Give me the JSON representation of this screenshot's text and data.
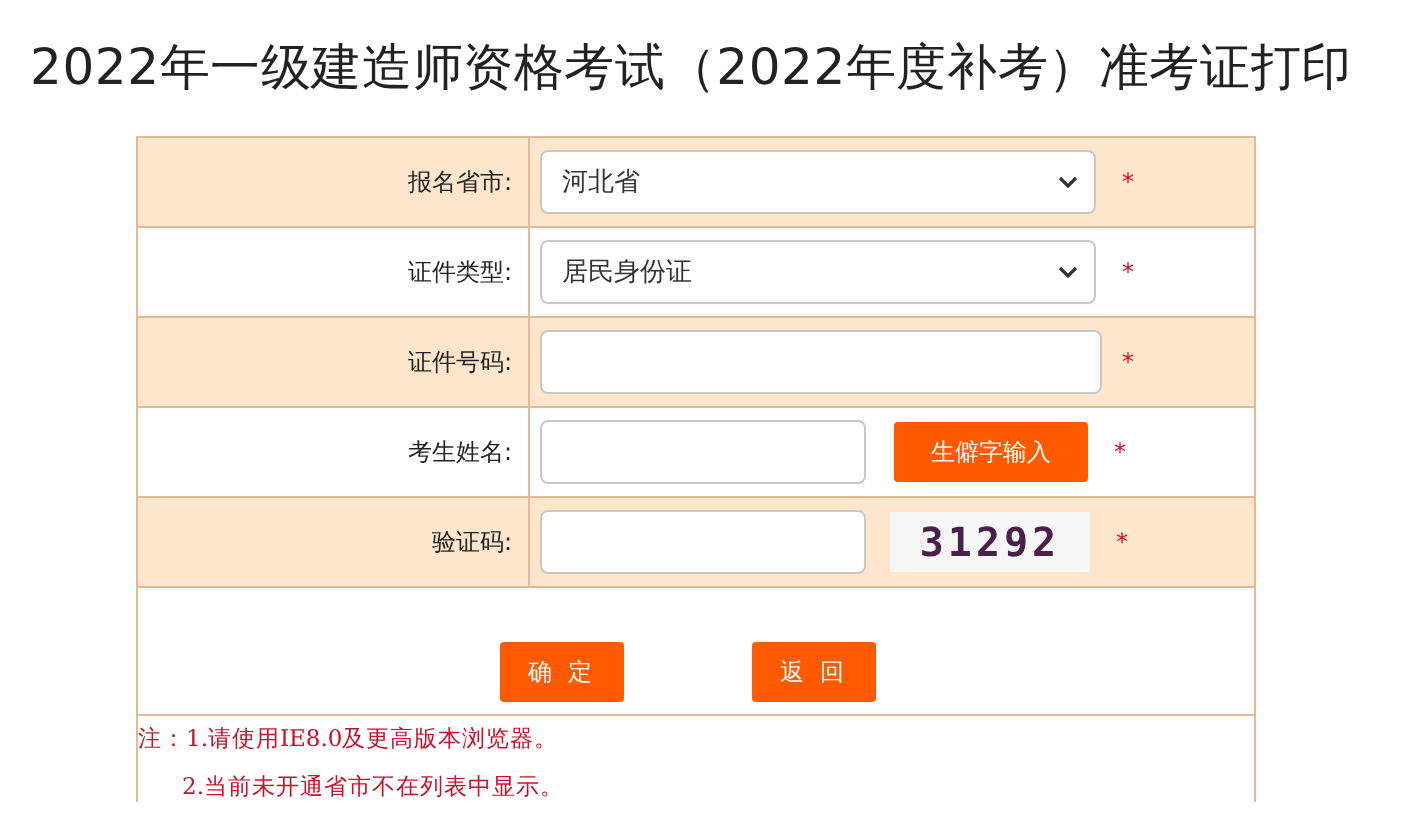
{
  "title": "2022年一级建造师资格考试（2022年度补考）准考证打印",
  "rows": [
    {
      "kind": "select",
      "label": "报名省市:",
      "value": "河北省",
      "required": "*"
    },
    {
      "kind": "select",
      "label": "证件类型:",
      "value": "居民身份证",
      "required": "*"
    },
    {
      "kind": "input",
      "label": "证件号码:",
      "required": "*"
    },
    {
      "kind": "button",
      "label": "考生姓名:",
      "button": "生僻字输入",
      "required": "*"
    },
    {
      "kind": "captcha",
      "label": "验证码:",
      "captcha": "31292",
      "required": "*"
    }
  ],
  "buttons": [
    "确 定",
    "返 回"
  ],
  "notes": [
    "注：1.请使用IE8.0及更高版本浏览器。",
    "2.当前未开通省市不在列表中显示。"
  ]
}
